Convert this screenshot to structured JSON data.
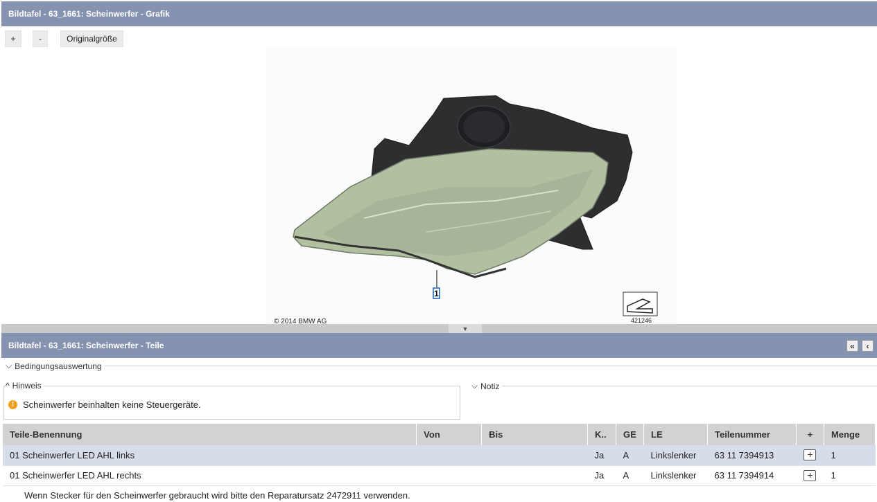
{
  "graphic_panel": {
    "title": "Bildtafel - 63_1661: Scheinwerfer - Grafik",
    "zoom_in_label": "+",
    "zoom_out_label": "-",
    "original_size_label": "Originalgröße",
    "copyright": "© 2014 BMW AG",
    "callout_number": "1",
    "image_id": "421246"
  },
  "parts_panel": {
    "title": "Bildtafel - 63_1661: Scheinwerfer - Teile",
    "collapse_all_label": "«",
    "collapse_label": "‹",
    "conditions_label": "Bedingungsauswertung",
    "hint_label": "Hinweis",
    "note_label": "Notiz",
    "hint_text": "Scheinwerfer beinhalten keine Steuergeräte."
  },
  "table": {
    "headers": [
      "Teile-Benennung",
      "Von",
      "Bis",
      "K..",
      "GE",
      "LE",
      "Teilenummer",
      "+",
      "Menge"
    ],
    "rows": [
      {
        "name": "01 Scheinwerfer LED AHL links",
        "von": "",
        "bis": "",
        "k": "Ja",
        "ge": "A",
        "le": "Linkslenker",
        "part_no": "63 11 7394913",
        "add": "+",
        "qty": "1"
      },
      {
        "name": "01 Scheinwerfer LED AHL rechts",
        "von": "",
        "bis": "",
        "k": "Ja",
        "ge": "A",
        "le": "Linkslenker",
        "part_no": "63 11 7394914",
        "add": "+",
        "qty": "1"
      }
    ],
    "footnote": "Wenn Stecker für den Scheinwerfer gebraucht wird bitte den Reparatursatz 2472911 verwenden."
  }
}
